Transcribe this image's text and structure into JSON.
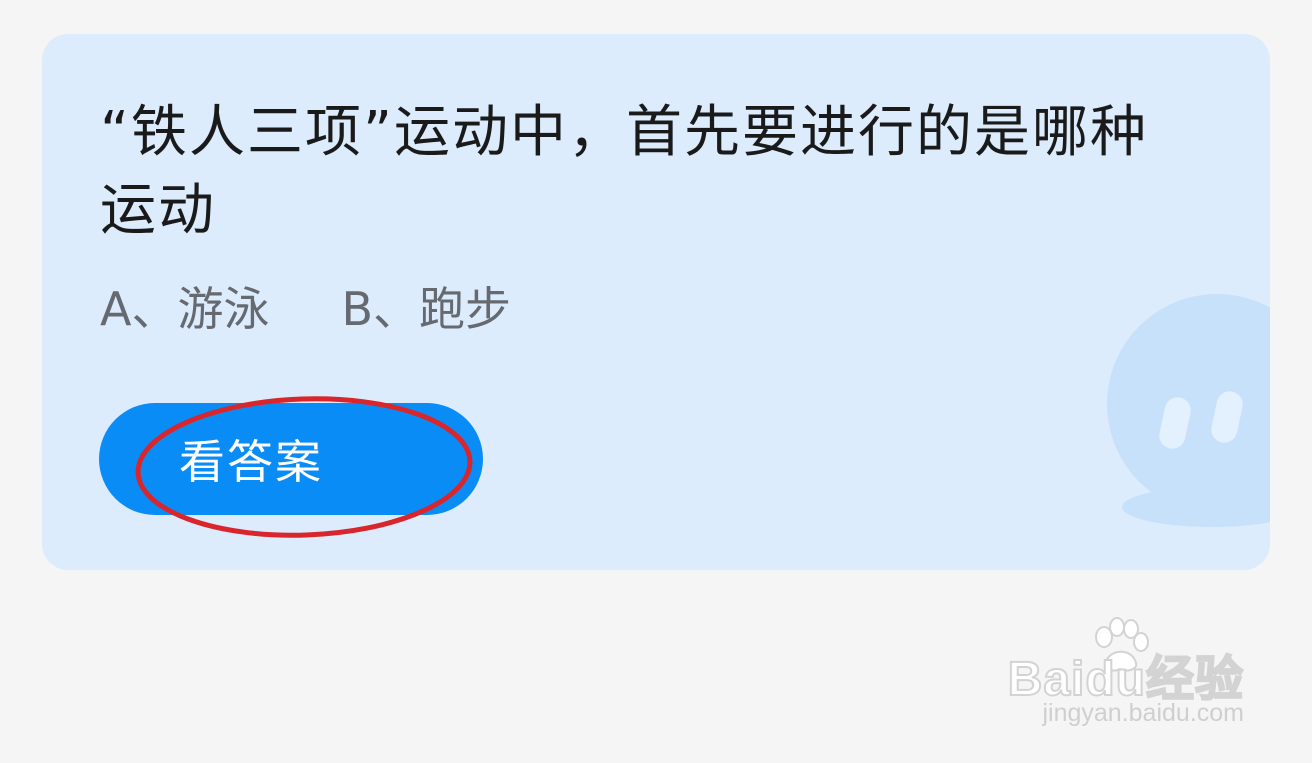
{
  "card": {
    "question": "“铁人三项”运动中，首先要进行的是哪种运动",
    "options": [
      {
        "label": "A、游泳"
      },
      {
        "label": "B、跑步"
      }
    ],
    "answer_button_label": "看答案"
  },
  "watermark": {
    "logo_text": "Baidu经验",
    "url": "jingyan.baidu.com"
  },
  "colors": {
    "page_background": "#f5f5f5",
    "card_background": "#dcecfd",
    "button": "#0a8cf7",
    "annotation_circle": "#d8262c"
  },
  "icons": {
    "mascot": "chat-bubble-mascot-icon",
    "annotation": "red-ellipse-highlight",
    "watermark_paw": "baidu-paw-icon"
  }
}
